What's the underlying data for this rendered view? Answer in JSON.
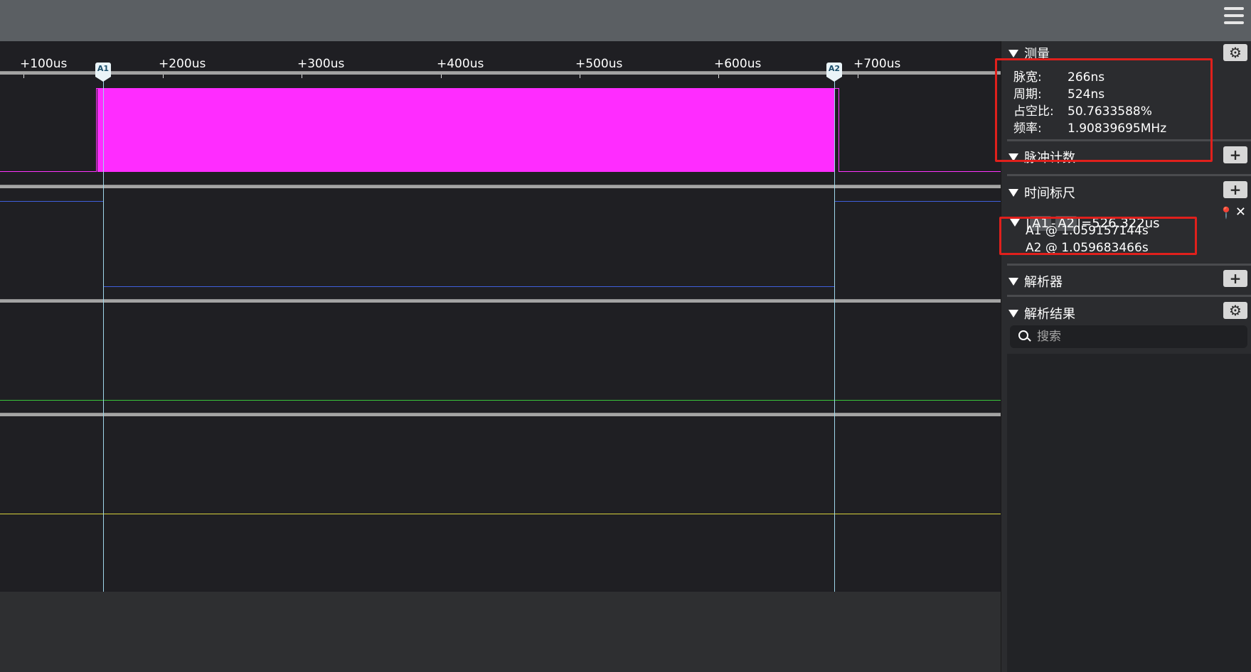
{
  "toolbar": {
    "menu_icon": "hamburger-menu-icon"
  },
  "timeline": {
    "ticks": [
      "+100us",
      "+200us",
      "+300us",
      "+400us",
      "+500us",
      "+600us",
      "+700us"
    ],
    "cursor_a1": "A1",
    "cursor_a2": "A2"
  },
  "channels": [
    {
      "color": "#ff33ff"
    },
    {
      "color": "#3f5fdc"
    },
    {
      "color": "#39c43a"
    },
    {
      "color": "#d8d23c"
    }
  ],
  "panel": {
    "measure": {
      "title": "测量",
      "settings_icon": "gear-icon",
      "rows": [
        {
          "label": "脉宽:",
          "value": "266ns"
        },
        {
          "label": "周期:",
          "value": "524ns"
        },
        {
          "label": "占空比:",
          "value": "50.7633588%"
        },
        {
          "label": "频率:",
          "value": "1.90839695MHz"
        }
      ]
    },
    "pulse_count": {
      "title": "脉冲计数",
      "add_label": "+"
    },
    "time_ruler": {
      "title": "时间标尺",
      "add_label": "+",
      "diff": {
        "bar_open": "|",
        "a1": "A1",
        "dash": "-",
        "a2": "A2",
        "result": "|=526.322us"
      },
      "a1_time": "A1 @ 1.059157144s",
      "a2_time": "A2 @ 1.059683466s",
      "pin_icon": "pin-icon",
      "close_icon": "close-icon"
    },
    "decoder": {
      "title": "解析器",
      "add_label": "+"
    },
    "decode_results": {
      "title": "解析结果",
      "settings_icon": "gear-icon",
      "search_placeholder": "搜索"
    }
  }
}
